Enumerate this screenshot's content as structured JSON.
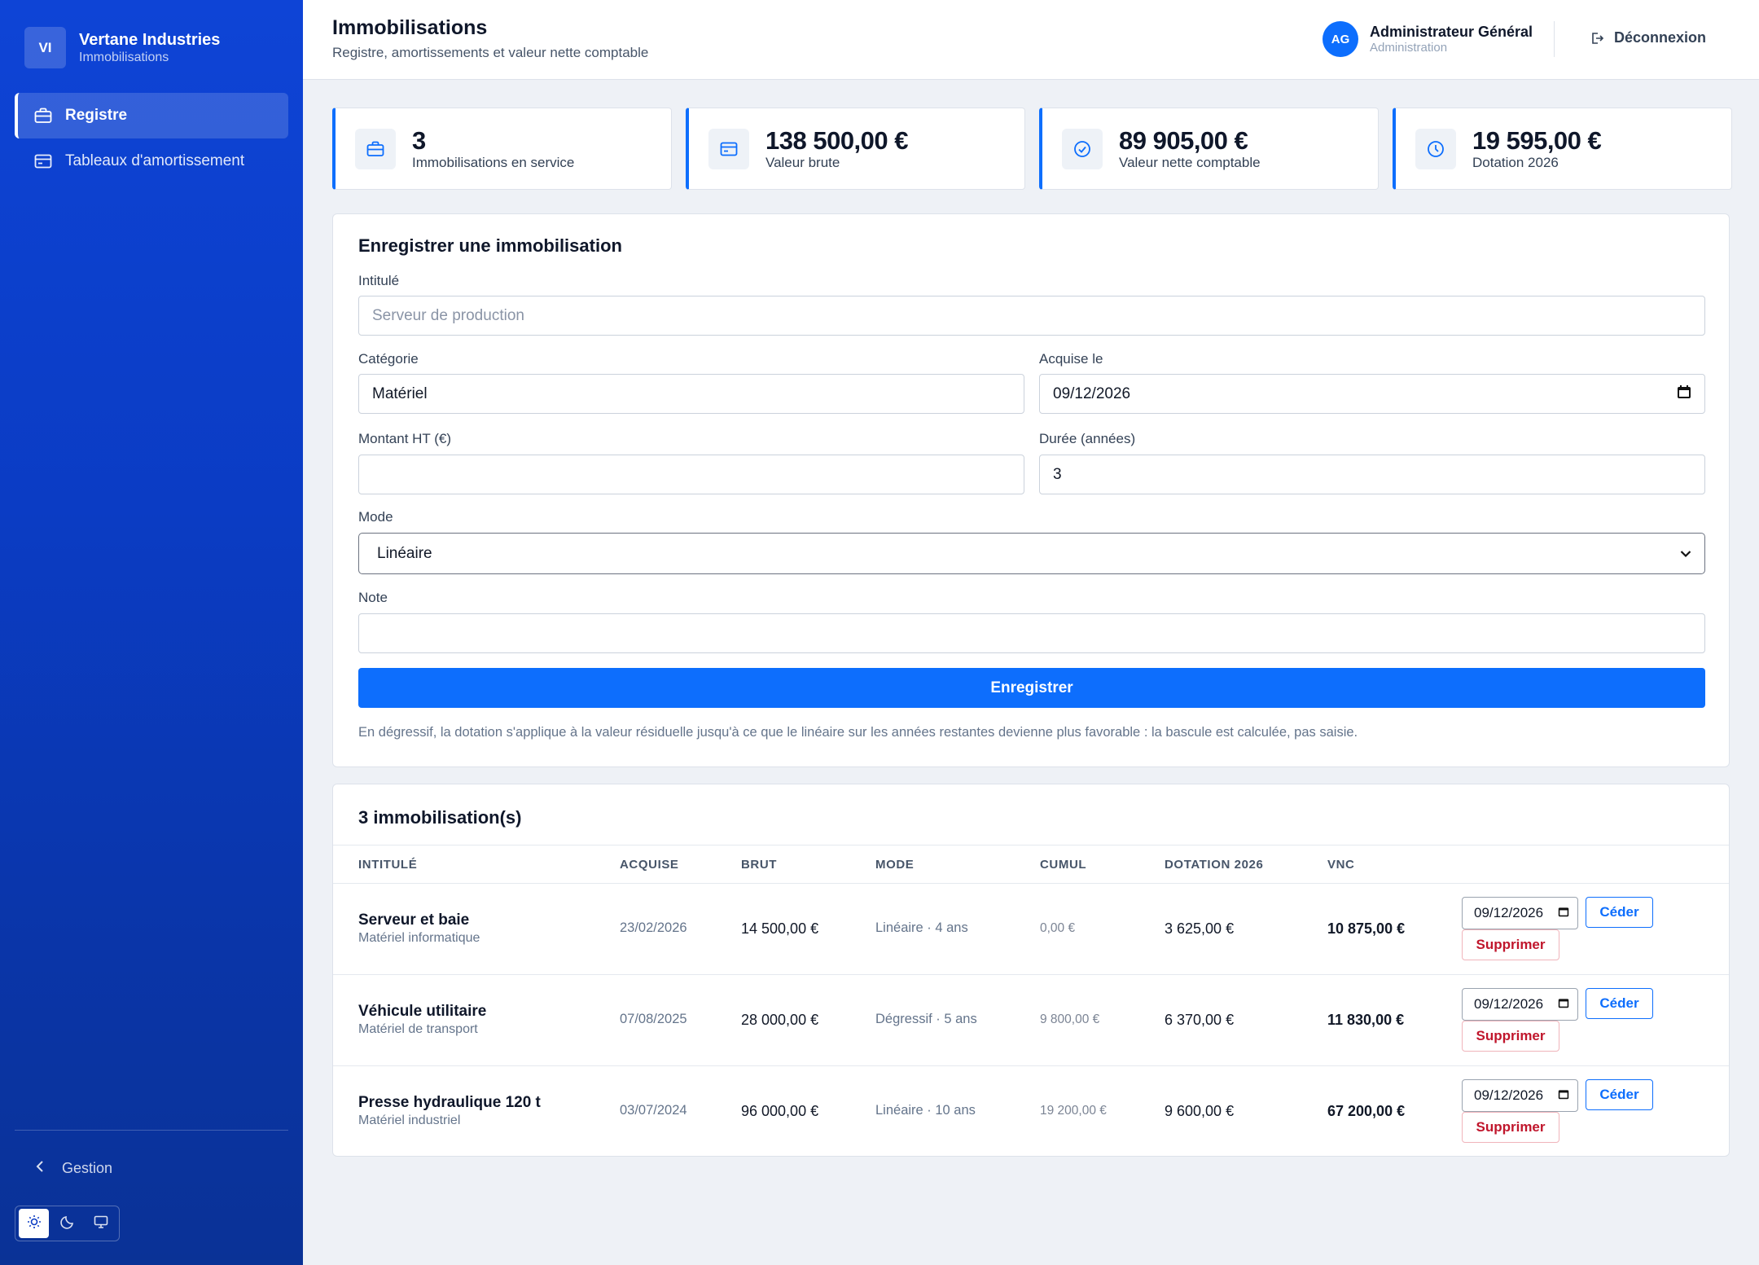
{
  "app": {
    "logo_initials": "VI",
    "company": "Vertane Industries",
    "module": "Immobilisations"
  },
  "sidebar": {
    "items": [
      {
        "label": "Registre",
        "icon": "briefcase-icon",
        "active": true
      },
      {
        "label": "Tableaux d'amortissement",
        "icon": "card-icon",
        "active": false
      }
    ],
    "back_label": "Gestion",
    "theme_options": [
      "light",
      "dark",
      "system"
    ],
    "theme_selected": "light"
  },
  "header": {
    "title": "Immobilisations",
    "subtitle": "Registre, amortissements et valeur nette comptable",
    "user_initials": "AG",
    "user_name": "Administrateur Général",
    "user_role": "Administration",
    "logout_label": "Déconnexion"
  },
  "stats": [
    {
      "value": "3",
      "label": "Immobilisations en service",
      "icon": "briefcase-icon"
    },
    {
      "value": "138 500,00 €",
      "label": "Valeur brute",
      "icon": "card-icon"
    },
    {
      "value": "89 905,00 €",
      "label": "Valeur nette comptable",
      "icon": "check-circle-icon"
    },
    {
      "value": "19 595,00 €",
      "label": "Dotation 2026",
      "icon": "clock-icon"
    }
  ],
  "form": {
    "title": "Enregistrer une immobilisation",
    "intitule_label": "Intitulé",
    "intitule_placeholder": "Serveur de production",
    "intitule_value": "",
    "categorie_label": "Catégorie",
    "categorie_value": "Matériel",
    "acquise_label": "Acquise le",
    "acquise_value": "09/12/2026",
    "montant_label": "Montant HT (€)",
    "montant_value": "",
    "duree_label": "Durée (années)",
    "duree_value": "3",
    "mode_label": "Mode",
    "mode_value": "Linéaire",
    "note_label": "Note",
    "note_value": "",
    "submit_label": "Enregistrer",
    "hint": "En dégressif, la dotation s'applique à la valeur résiduelle jusqu'à ce que le linéaire sur les années restantes devienne plus favorable : la bascule est calculée, pas saisie."
  },
  "table": {
    "title": "3 immobilisation(s)",
    "columns": [
      "INTITULÉ",
      "ACQUISE",
      "BRUT",
      "MODE",
      "CUMUL",
      "DOTATION 2026",
      "VNC"
    ],
    "rows": [
      {
        "name": "Serveur et baie",
        "category": "Matériel informatique",
        "acquired": "23/02/2026",
        "brut": "14 500,00 €",
        "mode": "Linéaire · 4 ans",
        "cumul": "0,00 €",
        "dotation": "3 625,00 €",
        "vnc": "10 875,00 €",
        "cession_date": "09/12/2026"
      },
      {
        "name": "Véhicule utilitaire",
        "category": "Matériel de transport",
        "acquired": "07/08/2025",
        "brut": "28 000,00 €",
        "mode": "Dégressif · 5 ans",
        "cumul": "9 800,00 €",
        "dotation": "6 370,00 €",
        "vnc": "11 830,00 €",
        "cession_date": "09/12/2026"
      },
      {
        "name": "Presse hydraulique 120 t",
        "category": "Matériel industriel",
        "acquired": "03/07/2024",
        "brut": "96 000,00 €",
        "mode": "Linéaire · 10 ans",
        "cumul": "19 200,00 €",
        "dotation": "9 600,00 €",
        "vnc": "67 200,00 €",
        "cession_date": "09/12/2026"
      }
    ],
    "ceder_label": "Céder",
    "supprimer_label": "Supprimer"
  }
}
